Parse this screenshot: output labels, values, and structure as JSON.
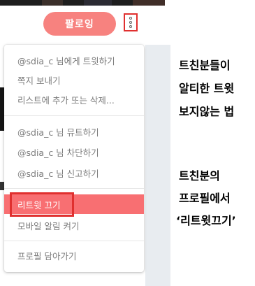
{
  "profile": {
    "follow_button": "팔로잉"
  },
  "menu": {
    "group1": [
      "@sdia_c 님에게 트윗하기",
      "쪽지 보내기",
      "리스트에 추가 또는 삭제..."
    ],
    "group2": [
      "@sdia_c 님 뮤트하기",
      "@sdia_c 님 차단하기",
      "@sdia_c 님 신고하기"
    ],
    "group3": [
      "리트윗 끄기",
      "모바일 알림 켜기"
    ],
    "group4": [
      "프로필 담아가기"
    ]
  },
  "captions": {
    "block1": [
      "트친분들이",
      "알티한 트윗",
      "보지않는 법"
    ],
    "block2": [
      "트친분의",
      "프로필에서",
      "‘리트윗끄기’"
    ]
  },
  "colors": {
    "accent": "#f86f72",
    "follow_button": "#f7827f",
    "annotation_red": "#e0302f",
    "menu_text": "#7c7c7c"
  },
  "icons": {
    "more": "vertical-ellipsis-icon"
  }
}
